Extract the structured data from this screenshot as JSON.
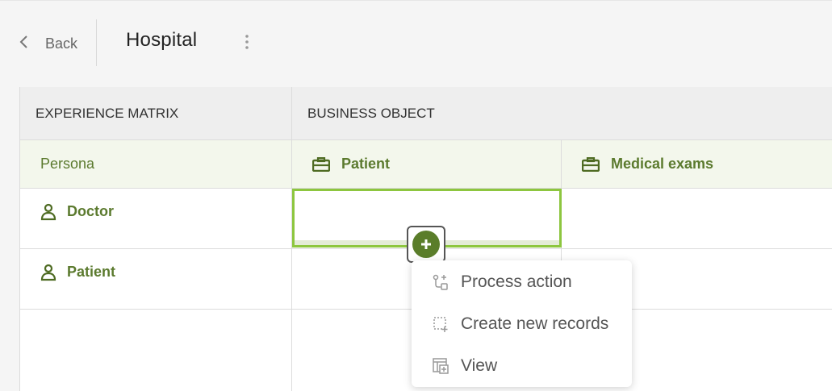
{
  "header": {
    "back_label": "Back",
    "title": "Hospital"
  },
  "matrix": {
    "experience_header": "EXPERIENCE MATRIX",
    "business_object_header": "BUSINESS OBJECT",
    "persona_header": "Persona",
    "business_objects": [
      "Patient",
      "Medical exams"
    ],
    "personas": [
      "Doctor",
      "Patient"
    ]
  },
  "menu": {
    "items": [
      {
        "label": "Process action",
        "icon": "process-action-icon"
      },
      {
        "label": "Create new records",
        "icon": "create-records-icon"
      },
      {
        "label": "View",
        "icon": "view-icon"
      }
    ]
  },
  "colors": {
    "accent": "#5a7d2a",
    "accent_light": "#8dc63f",
    "label_green": "#5b7a2e"
  }
}
